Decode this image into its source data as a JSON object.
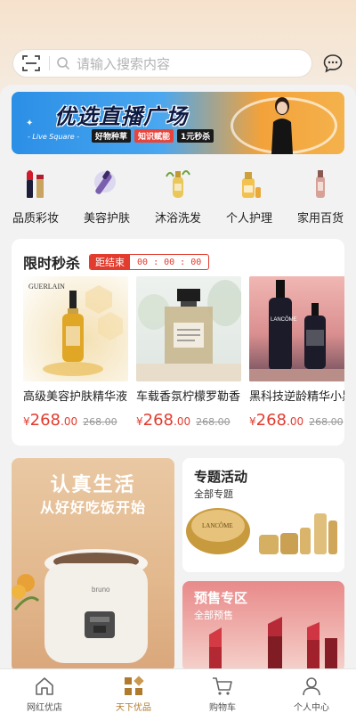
{
  "search": {
    "placeholder": "请输入搜索内容",
    "scan_icon": "scan-icon",
    "search_icon": "search-icon",
    "chat_icon": "chat-bubble-icon"
  },
  "banner": {
    "title": "优选直播广场",
    "subtitle": "- Live Square -",
    "tags": [
      "好物种草",
      "知识赋能",
      "1元秒杀"
    ]
  },
  "categories": [
    {
      "label": "品质彩妆",
      "icon": "lipstick-icon"
    },
    {
      "label": "美容护肤",
      "icon": "skincare-icon"
    },
    {
      "label": "沐浴洗发",
      "icon": "bath-icon"
    },
    {
      "label": "个人护理",
      "icon": "care-icon"
    },
    {
      "label": "家用百货",
      "icon": "household-icon"
    }
  ],
  "flash_sale": {
    "title": "限时秒杀",
    "badge_label": "距结束",
    "countdown": "00 : 00 : 00",
    "items": [
      {
        "name": "高级美容护肤精华液",
        "currency": "¥",
        "price": "268",
        "price_decimal": ".00",
        "old_price": "268.00",
        "brand_text": "GUERLAIN"
      },
      {
        "name": "车载香氛柠檬罗勒香",
        "currency": "¥",
        "price": "268",
        "price_decimal": ".00",
        "old_price": "268.00"
      },
      {
        "name": "黑科技逆龄精华小黑瓶",
        "currency": "¥",
        "price": "268",
        "price_decimal": ".00",
        "old_price": "268.00",
        "brand_text": "LANCÔME"
      }
    ]
  },
  "promo_left": {
    "title": "认真生活",
    "subtitle": "从好好吃饭开始",
    "brand_text": "bruno"
  },
  "promo_topic": {
    "title": "专题活动",
    "subtitle": "全部专题",
    "brand_text": "LANCÔME"
  },
  "promo_presale": {
    "title": "预售专区",
    "subtitle": "全部预售"
  },
  "tabbar": [
    {
      "label": "网红优店",
      "icon": "home-icon",
      "active": false
    },
    {
      "label": "天下优品",
      "icon": "grid-icon",
      "active": true
    },
    {
      "label": "购物车",
      "icon": "cart-icon",
      "active": false
    },
    {
      "label": "个人中心",
      "icon": "user-icon",
      "active": false
    }
  ],
  "colors": {
    "accent": "#e23c2f",
    "tab_active": "#b07a2d"
  }
}
